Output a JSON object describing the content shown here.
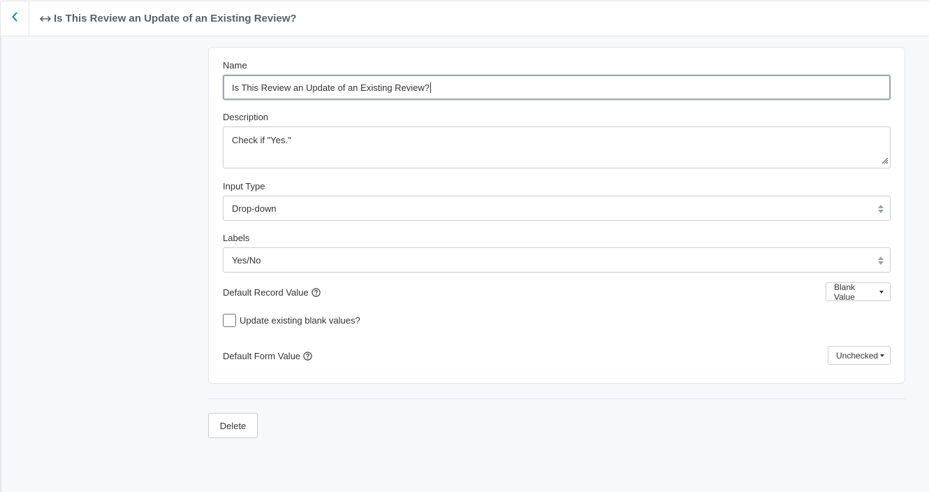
{
  "header": {
    "back_icon": "chevron-left-icon",
    "title_icon": "left-right-arrow-icon",
    "title": "Is This Review an Update of an Existing Review?"
  },
  "form": {
    "name_label": "Name",
    "name_value": "Is This Review an Update of an Existing Review?",
    "description_label": "Description",
    "description_value": "Check if \"Yes.\"",
    "input_type_label": "Input Type",
    "input_type_value": "Drop-down",
    "labels_label": "Labels",
    "labels_value": "Yes/No",
    "default_record_label": "Default Record Value",
    "default_record_value": "Blank Value",
    "update_blank_label": "Update existing blank values?",
    "update_blank_checked": false,
    "default_form_label": "Default Form Value",
    "default_form_value": "Unchecked"
  },
  "actions": {
    "delete_label": "Delete"
  },
  "colors": {
    "accent": "#1a73c8",
    "title_text": "#5b6068",
    "background": "#f7f8f9"
  }
}
